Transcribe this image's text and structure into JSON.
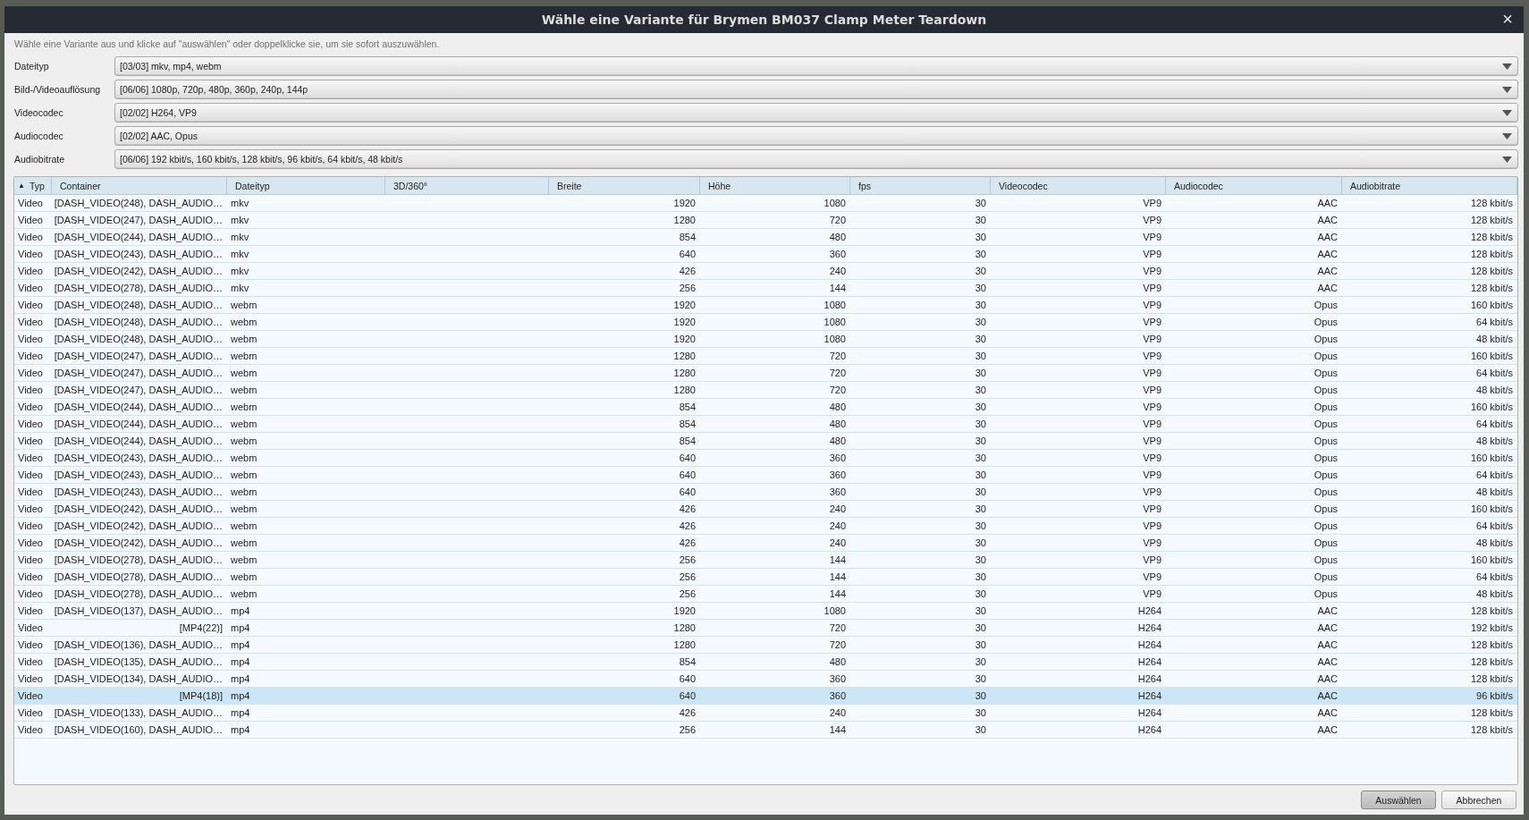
{
  "window": {
    "title": "Wähle eine Variante für Brymen BM037 Clamp Meter Teardown",
    "close": "×"
  },
  "hint": "Wähle eine Variante aus und klicke auf \"auswählen\" oder doppelklicke sie, um sie sofort auszuwählen.",
  "filters": [
    {
      "label": "Dateityp",
      "value": "[03/03] mkv, mp4, webm"
    },
    {
      "label": "Bild-/Videoauflösung",
      "value": "[06/06] 1080p, 720p, 480p, 360p, 240p, 144p"
    },
    {
      "label": "Videocodec",
      "value": "[02/02] H264, VP9"
    },
    {
      "label": "Audiocodec",
      "value": "[02/02] AAC, Opus"
    },
    {
      "label": "Audiobitrate",
      "value": "[06/06] 192 kbit/s, 160 kbit/s, 128 kbit/s, 96 kbit/s, 64 kbit/s, 48 kbit/s"
    }
  ],
  "table": {
    "columns": [
      {
        "label": "Typ",
        "sort": "▲"
      },
      {
        "label": "Container"
      },
      {
        "label": "Dateityp"
      },
      {
        "label": "3D/360°"
      },
      {
        "label": "Breite"
      },
      {
        "label": "Höhe"
      },
      {
        "label": "fps"
      },
      {
        "label": "Videocodec"
      },
      {
        "label": "Audiocodec"
      },
      {
        "label": "Audiobitrate"
      }
    ],
    "rows": [
      {
        "selected": false,
        "cells": [
          "Video",
          "[DASH_VIDEO(248), DASH_AUDIO…",
          "mkv",
          null,
          "1920",
          "1080",
          "30",
          "VP9",
          "AAC",
          "128 kbit/s"
        ]
      },
      {
        "selected": false,
        "cells": [
          "Video",
          "[DASH_VIDEO(247), DASH_AUDIO…",
          "mkv",
          null,
          "1280",
          "720",
          "30",
          "VP9",
          "AAC",
          "128 kbit/s"
        ]
      },
      {
        "selected": false,
        "cells": [
          "Video",
          "[DASH_VIDEO(244), DASH_AUDIO…",
          "mkv",
          null,
          "854",
          "480",
          "30",
          "VP9",
          "AAC",
          "128 kbit/s"
        ]
      },
      {
        "selected": false,
        "cells": [
          "Video",
          "[DASH_VIDEO(243), DASH_AUDIO…",
          "mkv",
          null,
          "640",
          "360",
          "30",
          "VP9",
          "AAC",
          "128 kbit/s"
        ]
      },
      {
        "selected": false,
        "cells": [
          "Video",
          "[DASH_VIDEO(242), DASH_AUDIO…",
          "mkv",
          null,
          "426",
          "240",
          "30",
          "VP9",
          "AAC",
          "128 kbit/s"
        ]
      },
      {
        "selected": false,
        "cells": [
          "Video",
          "[DASH_VIDEO(278), DASH_AUDIO…",
          "mkv",
          null,
          "256",
          "144",
          "30",
          "VP9",
          "AAC",
          "128 kbit/s"
        ]
      },
      {
        "selected": false,
        "cells": [
          "Video",
          "[DASH_VIDEO(248), DASH_AUDIO…",
          "webm",
          null,
          "1920",
          "1080",
          "30",
          "VP9",
          "Opus",
          "160 kbit/s"
        ]
      },
      {
        "selected": false,
        "cells": [
          "Video",
          "[DASH_VIDEO(248), DASH_AUDIO…",
          "webm",
          null,
          "1920",
          "1080",
          "30",
          "VP9",
          "Opus",
          "64 kbit/s"
        ]
      },
      {
        "selected": false,
        "cells": [
          "Video",
          "[DASH_VIDEO(248), DASH_AUDIO…",
          "webm",
          null,
          "1920",
          "1080",
          "30",
          "VP9",
          "Opus",
          "48 kbit/s"
        ]
      },
      {
        "selected": false,
        "cells": [
          "Video",
          "[DASH_VIDEO(247), DASH_AUDIO…",
          "webm",
          null,
          "1280",
          "720",
          "30",
          "VP9",
          "Opus",
          "160 kbit/s"
        ]
      },
      {
        "selected": false,
        "cells": [
          "Video",
          "[DASH_VIDEO(247), DASH_AUDIO…",
          "webm",
          null,
          "1280",
          "720",
          "30",
          "VP9",
          "Opus",
          "64 kbit/s"
        ]
      },
      {
        "selected": false,
        "cells": [
          "Video",
          "[DASH_VIDEO(247), DASH_AUDIO…",
          "webm",
          null,
          "1280",
          "720",
          "30",
          "VP9",
          "Opus",
          "48 kbit/s"
        ]
      },
      {
        "selected": false,
        "cells": [
          "Video",
          "[DASH_VIDEO(244), DASH_AUDIO…",
          "webm",
          null,
          "854",
          "480",
          "30",
          "VP9",
          "Opus",
          "160 kbit/s"
        ]
      },
      {
        "selected": false,
        "cells": [
          "Video",
          "[DASH_VIDEO(244), DASH_AUDIO…",
          "webm",
          null,
          "854",
          "480",
          "30",
          "VP9",
          "Opus",
          "64 kbit/s"
        ]
      },
      {
        "selected": false,
        "cells": [
          "Video",
          "[DASH_VIDEO(244), DASH_AUDIO…",
          "webm",
          null,
          "854",
          "480",
          "30",
          "VP9",
          "Opus",
          "48 kbit/s"
        ]
      },
      {
        "selected": false,
        "cells": [
          "Video",
          "[DASH_VIDEO(243), DASH_AUDIO…",
          "webm",
          null,
          "640",
          "360",
          "30",
          "VP9",
          "Opus",
          "160 kbit/s"
        ]
      },
      {
        "selected": false,
        "cells": [
          "Video",
          "[DASH_VIDEO(243), DASH_AUDIO…",
          "webm",
          null,
          "640",
          "360",
          "30",
          "VP9",
          "Opus",
          "64 kbit/s"
        ]
      },
      {
        "selected": false,
        "cells": [
          "Video",
          "[DASH_VIDEO(243), DASH_AUDIO…",
          "webm",
          null,
          "640",
          "360",
          "30",
          "VP9",
          "Opus",
          "48 kbit/s"
        ]
      },
      {
        "selected": false,
        "cells": [
          "Video",
          "[DASH_VIDEO(242), DASH_AUDIO…",
          "webm",
          null,
          "426",
          "240",
          "30",
          "VP9",
          "Opus",
          "160 kbit/s"
        ]
      },
      {
        "selected": false,
        "cells": [
          "Video",
          "[DASH_VIDEO(242), DASH_AUDIO…",
          "webm",
          null,
          "426",
          "240",
          "30",
          "VP9",
          "Opus",
          "64 kbit/s"
        ]
      },
      {
        "selected": false,
        "cells": [
          "Video",
          "[DASH_VIDEO(242), DASH_AUDIO…",
          "webm",
          null,
          "426",
          "240",
          "30",
          "VP9",
          "Opus",
          "48 kbit/s"
        ]
      },
      {
        "selected": false,
        "cells": [
          "Video",
          "[DASH_VIDEO(278), DASH_AUDIO…",
          "webm",
          null,
          "256",
          "144",
          "30",
          "VP9",
          "Opus",
          "160 kbit/s"
        ]
      },
      {
        "selected": false,
        "cells": [
          "Video",
          "[DASH_VIDEO(278), DASH_AUDIO…",
          "webm",
          null,
          "256",
          "144",
          "30",
          "VP9",
          "Opus",
          "64 kbit/s"
        ]
      },
      {
        "selected": false,
        "cells": [
          "Video",
          "[DASH_VIDEO(278), DASH_AUDIO…",
          "webm",
          null,
          "256",
          "144",
          "30",
          "VP9",
          "Opus",
          "48 kbit/s"
        ]
      },
      {
        "selected": false,
        "cells": [
          "Video",
          "[DASH_VIDEO(137), DASH_AUDIO…",
          "mp4",
          null,
          "1920",
          "1080",
          "30",
          "H264",
          "AAC",
          "128 kbit/s"
        ]
      },
      {
        "selected": false,
        "cells": [
          "Video",
          "[MP4(22)]",
          "mp4",
          null,
          "1280",
          "720",
          "30",
          "H264",
          "AAC",
          "192 kbit/s"
        ]
      },
      {
        "selected": false,
        "cells": [
          "Video",
          "[DASH_VIDEO(136), DASH_AUDIO…",
          "mp4",
          null,
          "1280",
          "720",
          "30",
          "H264",
          "AAC",
          "128 kbit/s"
        ]
      },
      {
        "selected": false,
        "cells": [
          "Video",
          "[DASH_VIDEO(135), DASH_AUDIO…",
          "mp4",
          null,
          "854",
          "480",
          "30",
          "H264",
          "AAC",
          "128 kbit/s"
        ]
      },
      {
        "selected": false,
        "cells": [
          "Video",
          "[DASH_VIDEO(134), DASH_AUDIO…",
          "mp4",
          null,
          "640",
          "360",
          "30",
          "H264",
          "AAC",
          "128 kbit/s"
        ]
      },
      {
        "selected": true,
        "cells": [
          "Video",
          "[MP4(18)]",
          "mp4",
          null,
          "640",
          "360",
          "30",
          "H264",
          "AAC",
          "96 kbit/s"
        ]
      },
      {
        "selected": false,
        "cells": [
          "Video",
          "[DASH_VIDEO(133), DASH_AUDIO…",
          "mp4",
          null,
          "426",
          "240",
          "30",
          "H264",
          "AAC",
          "128 kbit/s"
        ]
      },
      {
        "selected": false,
        "cells": [
          "Video",
          "[DASH_VIDEO(160), DASH_AUDIO…",
          "mp4",
          null,
          "256",
          "144",
          "30",
          "H264",
          "AAC",
          "128 kbit/s"
        ]
      }
    ]
  },
  "buttons": [
    {
      "label": "Auswählen",
      "kind": "default"
    },
    {
      "label": "Abbrechen",
      "kind": "normal"
    }
  ]
}
